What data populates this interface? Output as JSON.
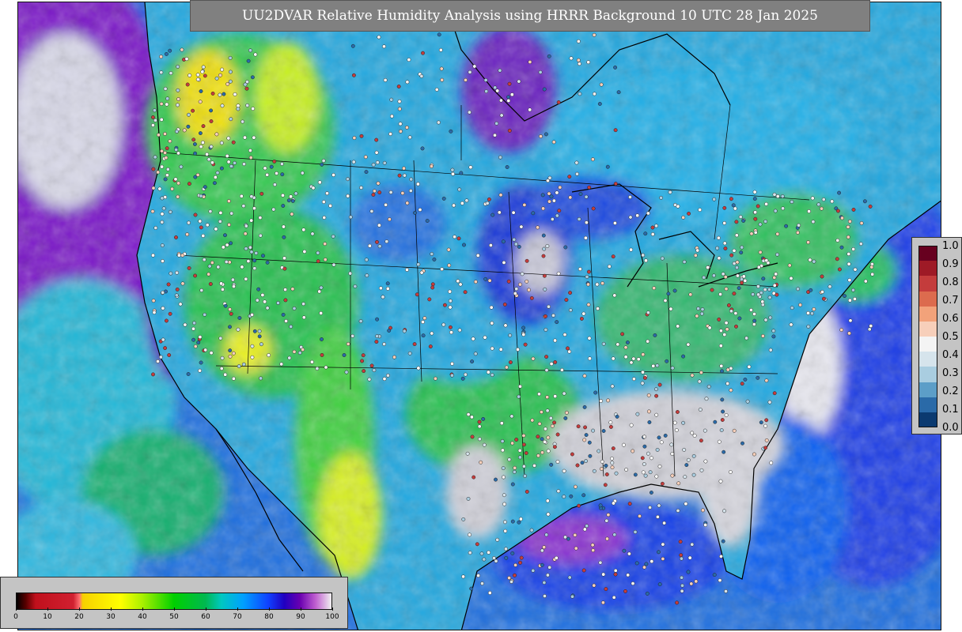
{
  "title": "UU2DVAR Relative Humidity Analysis using HRRR Background 10 UTC 28 Jan 2025",
  "map": {
    "ocean_color": "#1e6fe0",
    "land_boundary_color": "#000000"
  },
  "station_legend": {
    "ticks": [
      "1.0",
      "0.9",
      "0.8",
      "0.7",
      "0.6",
      "0.5",
      "0.4",
      "0.3",
      "0.2",
      "0.1",
      "0.0"
    ],
    "colors": [
      "#67001f",
      "#9e1a26",
      "#c43c3c",
      "#dc6b4e",
      "#f2a27a",
      "#f7cfba",
      "#f4f4f4",
      "#d6e4ec",
      "#a9cde0",
      "#5c9ec8",
      "#2a6aa8",
      "#0b3a70"
    ]
  },
  "rh_colorbar": {
    "ticks": [
      "0",
      "10",
      "20",
      "30",
      "40",
      "50",
      "60",
      "70",
      "80",
      "90",
      "100"
    ],
    "stops": [
      {
        "pct": 0,
        "color": "#000000"
      },
      {
        "pct": 3,
        "color": "#5a0000"
      },
      {
        "pct": 6,
        "color": "#c0101c"
      },
      {
        "pct": 18,
        "color": "#d02030"
      },
      {
        "pct": 20,
        "color": "#ff7070"
      },
      {
        "pct": 21,
        "color": "#f7d000"
      },
      {
        "pct": 33,
        "color": "#ffff00"
      },
      {
        "pct": 40,
        "color": "#a8f000"
      },
      {
        "pct": 50,
        "color": "#00d000"
      },
      {
        "pct": 60,
        "color": "#00b850"
      },
      {
        "pct": 65,
        "color": "#00c8c0"
      },
      {
        "pct": 72,
        "color": "#00a0ff"
      },
      {
        "pct": 80,
        "color": "#1040ff"
      },
      {
        "pct": 85,
        "color": "#2000c0"
      },
      {
        "pct": 90,
        "color": "#6a00b0"
      },
      {
        "pct": 95,
        "color": "#c060d0"
      },
      {
        "pct": 100,
        "color": "#f0f0f0"
      }
    ]
  }
}
